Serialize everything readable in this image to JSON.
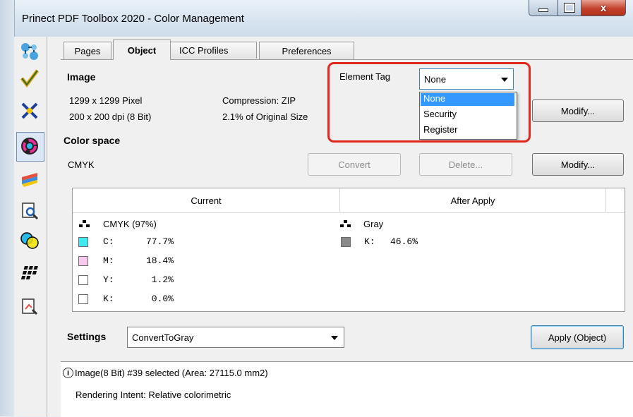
{
  "window": {
    "title": "Prinect PDF Toolbox 2020 - Color Management",
    "minimize_glyph": "▁",
    "maximize_glyph": "□",
    "close_glyph": "x"
  },
  "tabs": [
    {
      "label": "Pages"
    },
    {
      "label": "Object"
    },
    {
      "label": "ICC Profiles"
    },
    {
      "label": "Preferences"
    }
  ],
  "image_section": {
    "heading": "Image",
    "size": "1299 x 1299 Pixel",
    "resolution": "200 x 200 dpi (8 Bit)",
    "compression": "Compression: ZIP",
    "original_size": "2.1% of Original Size",
    "modify_label": "Modify..."
  },
  "element_tag": {
    "label": "Element Tag",
    "selected": "None",
    "options": [
      "None",
      "Security",
      "Register"
    ]
  },
  "color_space": {
    "heading": "Color space",
    "value": "CMYK",
    "convert_label": "Convert",
    "delete_label": "Delete...",
    "modify_label": "Modify..."
  },
  "table": {
    "headers": [
      "Current",
      "After Apply"
    ],
    "current": {
      "space": "CMYK (97%)",
      "channels": [
        {
          "label": "C:",
          "value": "77.7%",
          "color": "#40e8ef"
        },
        {
          "label": "M:",
          "value": "18.4%",
          "color": "#f9c8ef"
        },
        {
          "label": "Y:",
          "value": "1.2%",
          "color": "#ffffff"
        },
        {
          "label": "K:",
          "value": "0.0%",
          "color": "#ffffff"
        }
      ]
    },
    "after": {
      "space": "Gray",
      "channels": [
        {
          "label": "K:",
          "value": "46.6%",
          "color": "#898989"
        }
      ]
    }
  },
  "settings": {
    "label": "Settings",
    "selected": "ConvertToGray",
    "apply_label": "Apply (Object)"
  },
  "status": {
    "line1": "Image(8 Bit) #39 selected  (Area: 27115.0 mm2)",
    "line2": "Rendering Intent: Relative colorimetric",
    "info_glyph": "i"
  },
  "colors": {
    "highlight_frame": "#e1261c",
    "selection": "#3399ff"
  }
}
